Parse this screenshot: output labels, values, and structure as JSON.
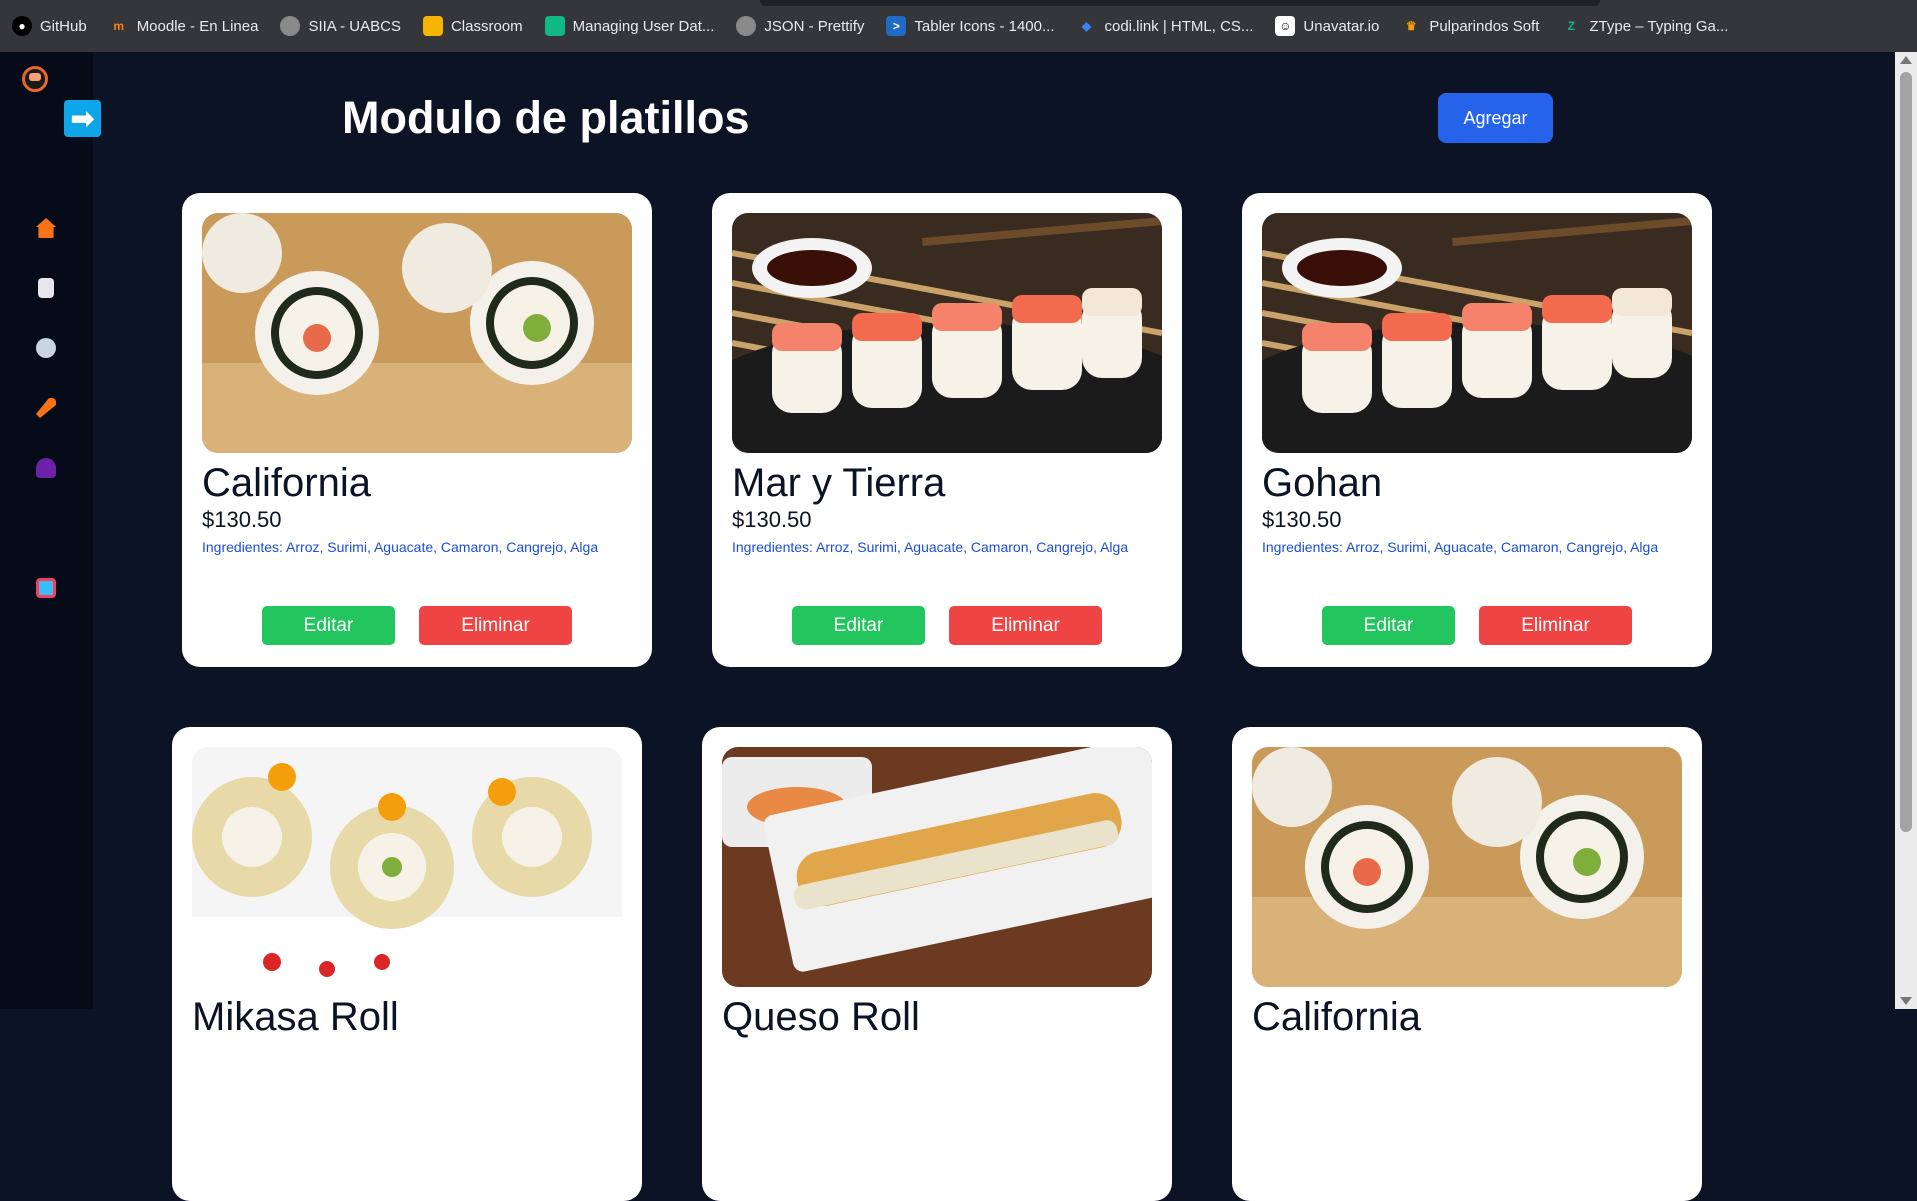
{
  "bookmarks": [
    {
      "label": "GitHub",
      "icon": "github-icon",
      "color": "#ffffff"
    },
    {
      "label": "Moodle - En Linea",
      "icon": "moodle-icon",
      "color": "#f98012"
    },
    {
      "label": "SIIA - UABCS",
      "icon": "globe-icon",
      "color": "#bdbdbd"
    },
    {
      "label": "Classroom",
      "icon": "classroom-icon",
      "color": "#f4b400"
    },
    {
      "label": "Managing User Dat...",
      "icon": "managing-icon",
      "color": "#10b981"
    },
    {
      "label": "JSON - Prettify",
      "icon": "globe-icon",
      "color": "#bdbdbd"
    },
    {
      "label": "Tabler Icons - 1400...",
      "icon": "tabler-icon",
      "color": "#206bc4"
    },
    {
      "label": "codi.link | HTML, CS...",
      "icon": "codi-icon",
      "color": "#3b82f6"
    },
    {
      "label": "Unavatar.io",
      "icon": "unavatar-icon",
      "color": "#ffffff"
    },
    {
      "label": "Pulparindos Soft",
      "icon": "pulparindos-icon",
      "color": "#f59e0b"
    },
    {
      "label": "ZType – Typing Ga...",
      "icon": "ztype-icon",
      "color": "#10b981"
    }
  ],
  "sidebar": {
    "items": [
      {
        "name": "home-icon",
        "color": "#f97316"
      },
      {
        "name": "document-icon",
        "color": "#e5e7eb"
      },
      {
        "name": "plate-icon",
        "color": "#cbd5e1"
      },
      {
        "name": "carrot-icon",
        "color": "#f97316"
      },
      {
        "name": "user-icon",
        "color": "#6b21a8"
      },
      {
        "name": "logout-icon",
        "color": "#38bdf8"
      }
    ]
  },
  "header": {
    "title": "Modulo de platillos",
    "add_label": "Agregar"
  },
  "cards": [
    {
      "name": "California",
      "price": "$130.50",
      "ingredients": "Ingredientes: Arroz, Surimi, Aguacate, Camaron, Cangrejo, Alga",
      "edit": "Editar",
      "delete": "Eliminar"
    },
    {
      "name": "Mar y Tierra",
      "price": "$130.50",
      "ingredients": "Ingredientes: Arroz, Surimi, Aguacate, Camaron, Cangrejo, Alga",
      "edit": "Editar",
      "delete": "Eliminar"
    },
    {
      "name": "Gohan",
      "price": "$130.50",
      "ingredients": "Ingredientes: Arroz, Surimi, Aguacate, Camaron, Cangrejo, Alga",
      "edit": "Editar",
      "delete": "Eliminar"
    },
    {
      "name": "Mikasa Roll"
    },
    {
      "name": "Queso Roll"
    },
    {
      "name": "California"
    }
  ],
  "colors": {
    "background": "#0b1324",
    "accent_blue": "#2563eb",
    "edit_green": "#22c55e",
    "delete_red": "#ef4444"
  }
}
